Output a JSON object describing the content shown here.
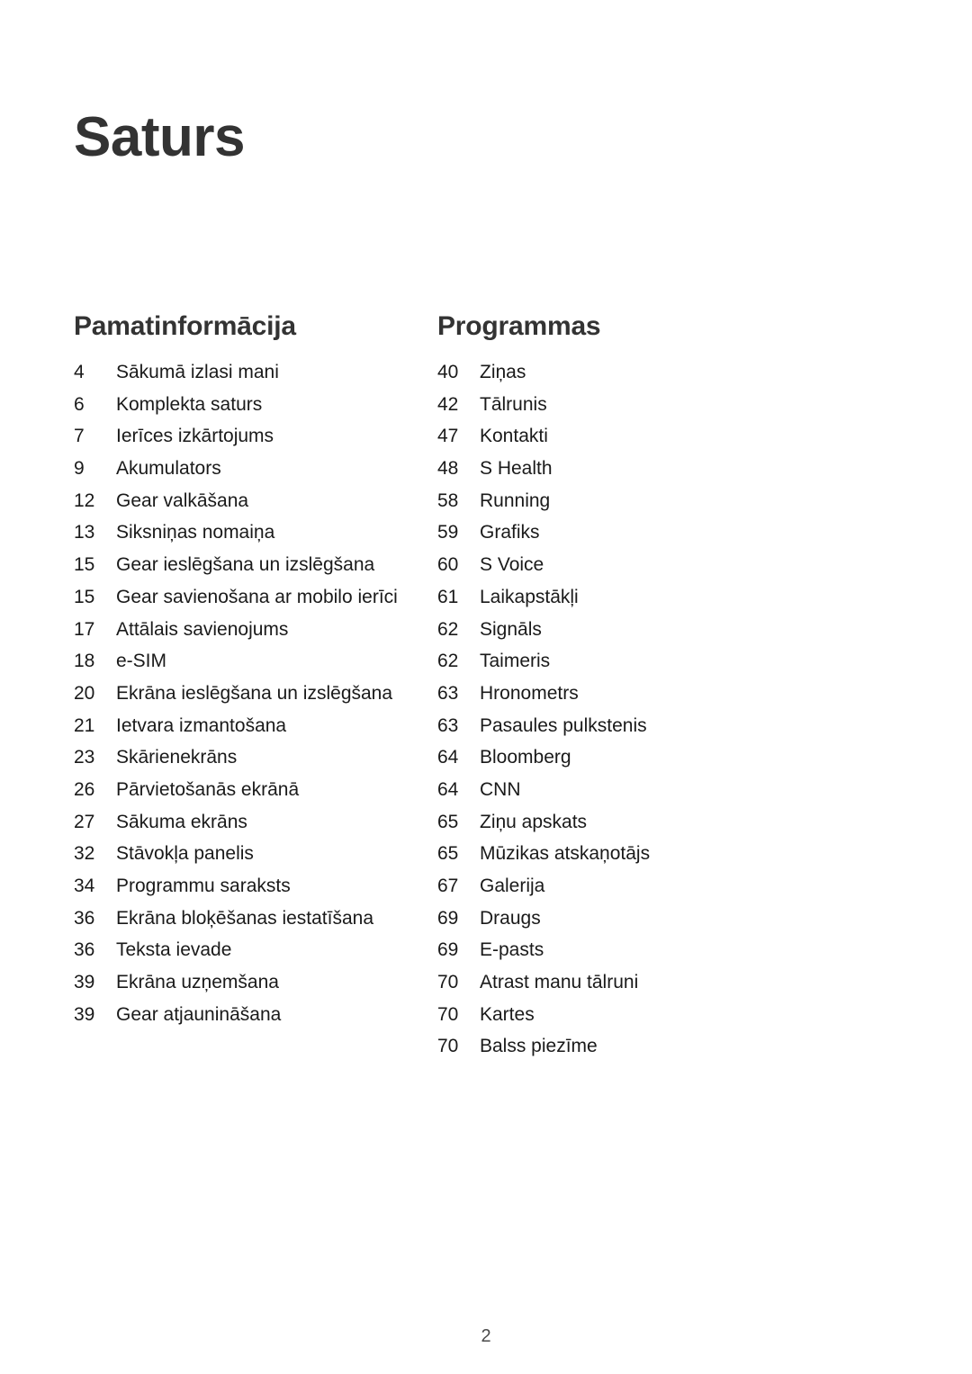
{
  "document": {
    "title": "Saturs",
    "page_number": "2"
  },
  "sections": [
    {
      "heading": "Pamatinformācija",
      "entries": [
        {
          "page": "4",
          "label": "Sākumā izlasi mani"
        },
        {
          "page": "6",
          "label": "Komplekta saturs"
        },
        {
          "page": "7",
          "label": "Ierīces izkārtojums"
        },
        {
          "page": "9",
          "label": "Akumulators"
        },
        {
          "page": "12",
          "label": "Gear valkāšana"
        },
        {
          "page": "13",
          "label": "Siksniņas nomaiņa"
        },
        {
          "page": "15",
          "label": "Gear ieslēgšana un izslēgšana"
        },
        {
          "page": "15",
          "label": "Gear savienošana ar mobilo ierīci"
        },
        {
          "page": "17",
          "label": "Attālais savienojums"
        },
        {
          "page": "18",
          "label": "e-SIM"
        },
        {
          "page": "20",
          "label": "Ekrāna ieslēgšana un izslēgšana"
        },
        {
          "page": "21",
          "label": "Ietvara izmantošana"
        },
        {
          "page": "23",
          "label": "Skārienekrāns"
        },
        {
          "page": "26",
          "label": "Pārvietošanās ekrānā"
        },
        {
          "page": "27",
          "label": "Sākuma ekrāns"
        },
        {
          "page": "32",
          "label": "Stāvokļa panelis"
        },
        {
          "page": "34",
          "label": "Programmu saraksts"
        },
        {
          "page": "36",
          "label": "Ekrāna bloķēšanas iestatīšana"
        },
        {
          "page": "36",
          "label": "Teksta ievade"
        },
        {
          "page": "39",
          "label": "Ekrāna uzņemšana"
        },
        {
          "page": "39",
          "label": "Gear atjaunināšana"
        }
      ]
    },
    {
      "heading": "Programmas",
      "entries": [
        {
          "page": "40",
          "label": "Ziņas"
        },
        {
          "page": "42",
          "label": "Tālrunis"
        },
        {
          "page": "47",
          "label": "Kontakti"
        },
        {
          "page": "48",
          "label": "S Health"
        },
        {
          "page": "58",
          "label": "Running"
        },
        {
          "page": "59",
          "label": "Grafiks"
        },
        {
          "page": "60",
          "label": "S Voice"
        },
        {
          "page": "61",
          "label": "Laikapstākļi"
        },
        {
          "page": "62",
          "label": "Signāls"
        },
        {
          "page": "62",
          "label": "Taimeris"
        },
        {
          "page": "63",
          "label": "Hronometrs"
        },
        {
          "page": "63",
          "label": "Pasaules pulkstenis"
        },
        {
          "page": "64",
          "label": "Bloomberg"
        },
        {
          "page": "64",
          "label": "CNN"
        },
        {
          "page": "65",
          "label": "Ziņu apskats"
        },
        {
          "page": "65",
          "label": "Mūzikas atskaņotājs"
        },
        {
          "page": "67",
          "label": "Galerija"
        },
        {
          "page": "69",
          "label": "Draugs"
        },
        {
          "page": "69",
          "label": "E-pasts"
        },
        {
          "page": "70",
          "label": "Atrast manu tālruni"
        },
        {
          "page": "70",
          "label": "Kartes"
        },
        {
          "page": "70",
          "label": "Balss piezīme"
        }
      ]
    }
  ]
}
